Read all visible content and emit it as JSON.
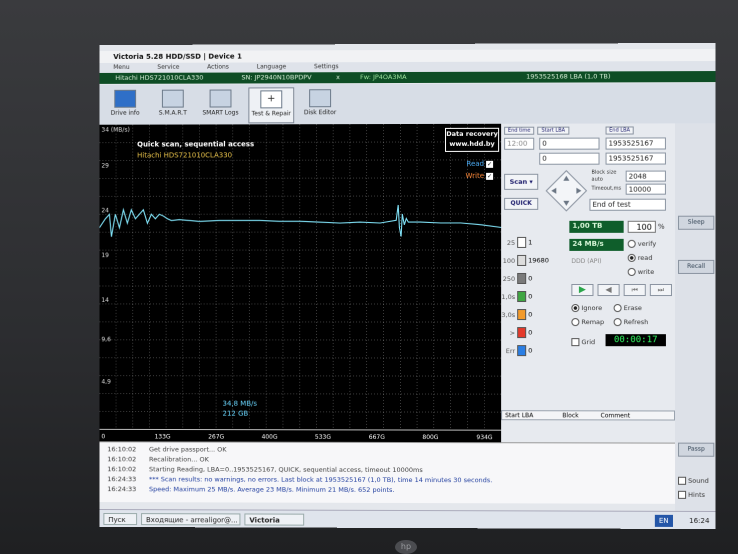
{
  "window": {
    "title": "Victoria 5.28 HDD/SSD | Device 1",
    "menu": [
      "Menu",
      "Service",
      "Actions",
      "Language",
      "Settings"
    ]
  },
  "info": {
    "model": "Hitachi HDS721010CLA330",
    "serial": "SN: JP2940N10BPDPV",
    "close": "x",
    "firmware": "Fw: JP4OA3MA",
    "lba": "1953525168 LBA (1,0 TB)"
  },
  "toolbar": [
    "Drive info",
    "S.M.A.R.T",
    "SMART Logs",
    "Test & Repair",
    "Disk Editor"
  ],
  "graph": {
    "ymax_label": "34 (MB/s)",
    "title": "Quick scan, sequential access",
    "model": "Hitachi HDS721010CLA330",
    "data_recovery": [
      "Data recovery",
      "www.hdd.by"
    ],
    "read_label": "Read",
    "write_label": "Write",
    "speed_readout": "34,8 MB/s",
    "size_readout": "212 GB"
  },
  "chart_data": {
    "type": "line",
    "y_ticks": [
      "29",
      "24",
      "19",
      "14",
      "9,6",
      "4,9"
    ],
    "x_ticks": [
      "0",
      "133G",
      "267G",
      "400G",
      "533G",
      "667G",
      "800G",
      "934G"
    ],
    "ylim": [
      0,
      34
    ],
    "xlim": [
      0,
      1000
    ],
    "grid": true,
    "series": [
      {
        "x": [
          0,
          15,
          25,
          30,
          40,
          50,
          60,
          70,
          80,
          90,
          100,
          110,
          120,
          130,
          140,
          150,
          160,
          170,
          180,
          200,
          250,
          300,
          350,
          400,
          450,
          500,
          550,
          600,
          650,
          700,
          740,
          745,
          748,
          752,
          755,
          760,
          765,
          770,
          800,
          850,
          900,
          950,
          1000
        ],
        "y": [
          22.5,
          23.5,
          24,
          21.5,
          24,
          22.5,
          24.5,
          23,
          24.5,
          23.5,
          24,
          24.5,
          23,
          24,
          23.5,
          24,
          23.8,
          23.5,
          23.3,
          23.4,
          23.2,
          23.3,
          23.3,
          23.3,
          23.2,
          23.2,
          23.1,
          23.0,
          23.1,
          23.0,
          23.3,
          25,
          22.5,
          21.5,
          24,
          22.8,
          23.5,
          23.1,
          23.1,
          23.0,
          23.0,
          22.8,
          22.5
        ]
      }
    ]
  },
  "panel": {
    "end_time": "End time",
    "start_lba": "Start LBA",
    "end_lba": "End LBA",
    "time_value": "12:00",
    "start_value": "0",
    "end_value": "1953525167",
    "zero_value": "0",
    "end_value2": "1953525167",
    "scan": "Scan",
    "quick": "QUICK",
    "block_size_label": "Block size",
    "auto_label": "auto",
    "timeout_label": "Timeout,ms",
    "block_size": "2048",
    "timeout": "10000",
    "end_action": "End of test",
    "tb_readout": "1,00 TB",
    "percent": "100",
    "percent_sign": "%",
    "speed": "24 MB/s",
    "ddd_label": "DDD (API)",
    "verify": "verify",
    "read": "read",
    "write": "write",
    "ignore": "Ignore",
    "erase": "Erase",
    "remap": "Remap",
    "refresh": "Refresh",
    "grid": "Grid",
    "timer": "00:00:17",
    "table": [
      "Start LBA",
      "Block",
      "Comment"
    ],
    "blocks": [
      {
        "label": "25",
        "count": "1"
      },
      {
        "label": "100",
        "count": "19680"
      },
      {
        "label": "250",
        "count": "0"
      },
      {
        "label": "1,0s",
        "count": "0"
      },
      {
        "label": "3,0s",
        "count": "0"
      },
      {
        "label": ">",
        "count": "0"
      },
      {
        "label": "Err",
        "count": "0"
      }
    ]
  },
  "rightcol": {
    "sleep": "Sleep",
    "recall": "Recall",
    "passp": "Passp",
    "sound": "Sound",
    "hints": "Hints"
  },
  "log": [
    {
      "time": "16:10:02",
      "text": "Get drive passport... OK"
    },
    {
      "time": "16:10:02",
      "text": "Recalibration... OK"
    },
    {
      "time": "16:10:02",
      "text": "Starting Reading, LBA=0..1953525167, QUICK, sequential access, timeout 10000ms"
    },
    {
      "time": "16:24:33",
      "text": "*** Scan results: no warnings, no errors. Last block at 1953525167 (1,0 TB), time 14 minutes 30 seconds."
    },
    {
      "time": "16:24:33",
      "text": "Speed: Maximum 25 MB/s. Average 23 MB/s. Minimum 21 MB/s. 652 points."
    }
  ],
  "taskbar": {
    "start": "Пуск",
    "mail": "Входящие - arrealigor@...",
    "app": "Victoria",
    "lang": "EN",
    "clock": "16:24"
  },
  "logo": "hp"
}
